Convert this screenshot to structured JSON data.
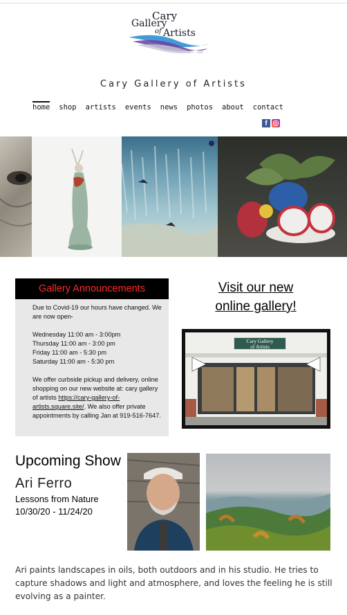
{
  "logo": {
    "line1": "Cary",
    "line2": "Gallery",
    "line3": "of",
    "line4": "Artists"
  },
  "site_title": "Cary Gallery of Artists",
  "nav": [
    {
      "label": "home",
      "active": true
    },
    {
      "label": "shop"
    },
    {
      "label": "artists"
    },
    {
      "label": "events"
    },
    {
      "label": "news"
    },
    {
      "label": "photos"
    },
    {
      "label": "about"
    },
    {
      "label": "contact"
    }
  ],
  "social": {
    "facebook_glyph": "f",
    "instagram_icon": "instagram-icon"
  },
  "announcements": {
    "heading": "Gallery Announcements",
    "covid": "Due to Covid-19 our hours have changed. We are now open-",
    "hours": [
      "Wednesday 11:00 am - 3:00pm",
      "Thursday 11:00 am - 3:00 pm",
      "Friday 11:00 am - 5:30 pm",
      "Saturday 11:00 am - 5:30 pm"
    ],
    "pickup_pre": "We offer curbside pickup and delivery, online shopping on our new website at: cary gallery of artists ",
    "pickup_link": "https://cary-gallery-of-artists.square.site/",
    "pickup_post": ". We also offer private appointments by calling Jan at 919-516-7647."
  },
  "visit": {
    "line1": "Visit our new",
    "line2": "online gallery!"
  },
  "storefront_sign": {
    "line1": "Cary Gallery",
    "line2": "of Artists"
  },
  "show": {
    "heading": "Upcoming Show",
    "artist": "Ari Ferro",
    "title": "Lessons from Nature",
    "dates": "10/30/20 - 11/24/20",
    "bio": "Ari paints landscapes in oils, both outdoors and in his studio. He tries to capture shadows and light and atmosphere, and loves the feeling he is still evolving as a painter."
  },
  "colors": {
    "announce_heading": "#ff2a2a",
    "announce_bg": "#e8e8e8",
    "facebook": "#3b5998"
  }
}
